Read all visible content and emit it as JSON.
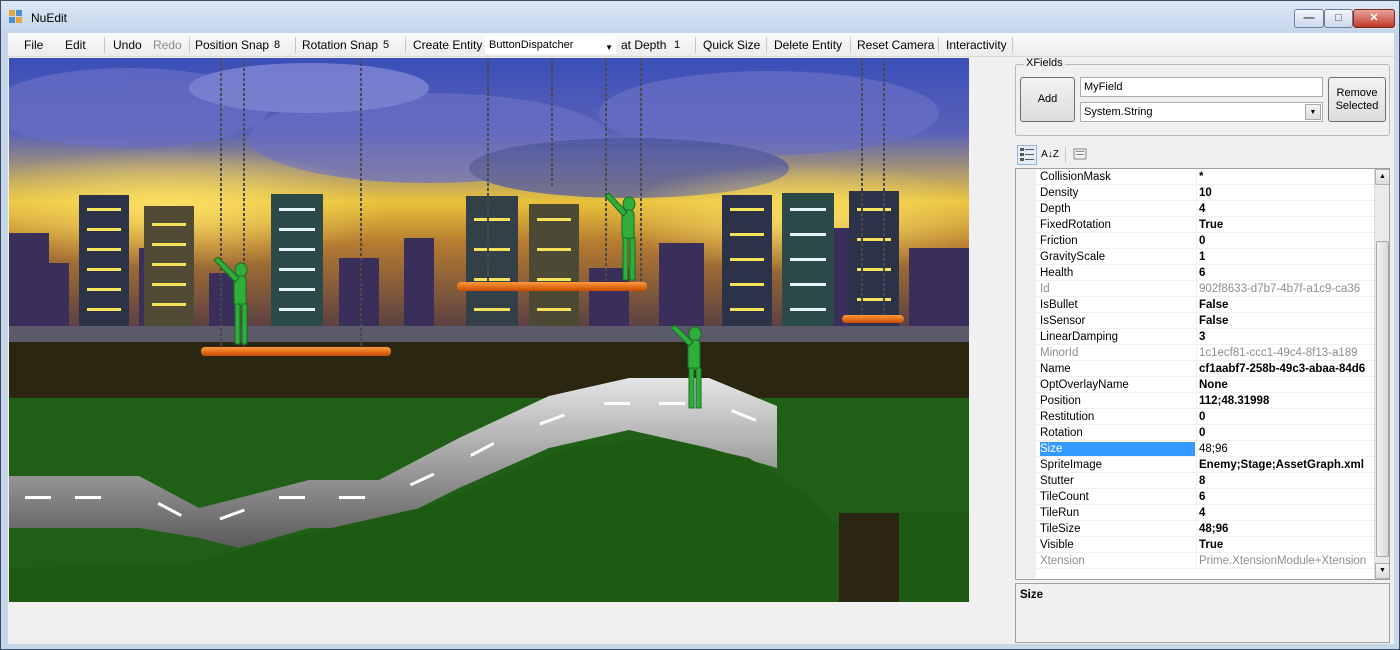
{
  "window": {
    "title": "NuEdit",
    "minimize_glyph": "—",
    "maximize_glyph": "□",
    "close_glyph": "✕"
  },
  "toolbar": {
    "file": "File",
    "edit": "Edit",
    "undo": "Undo",
    "redo": "Redo",
    "position_snap_label": "Position Snap",
    "position_snap_value": "8",
    "rotation_snap_label": "Rotation Snap",
    "rotation_snap_value": "5",
    "create_entity_label": "Create Entity",
    "entity_type": "ButtonDispatcher",
    "at_depth_label": "at Depth",
    "depth_value": "1",
    "quick_size": "Quick Size",
    "delete_entity": "Delete Entity",
    "reset_camera": "Reset Camera",
    "interactivity": "Interactivity"
  },
  "xfields": {
    "legend": "XFields",
    "add_label": "Add",
    "field_name": "MyField",
    "field_type": "System.String",
    "remove_label_1": "Remove",
    "remove_label_2": "Selected"
  },
  "properties": [
    {
      "key": "CollisionMask",
      "value": "*",
      "readonly": false
    },
    {
      "key": "Density",
      "value": "10",
      "readonly": false
    },
    {
      "key": "Depth",
      "value": "4",
      "readonly": false
    },
    {
      "key": "FixedRotation",
      "value": "True",
      "readonly": false
    },
    {
      "key": "Friction",
      "value": "0",
      "readonly": false
    },
    {
      "key": "GravityScale",
      "value": "1",
      "readonly": false
    },
    {
      "key": "Health",
      "value": "6",
      "readonly": false
    },
    {
      "key": "Id",
      "value": "902f8633-d7b7-4b7f-a1c9-ca36",
      "readonly": true
    },
    {
      "key": "IsBullet",
      "value": "False",
      "readonly": false
    },
    {
      "key": "IsSensor",
      "value": "False",
      "readonly": false
    },
    {
      "key": "LinearDamping",
      "value": "3",
      "readonly": false
    },
    {
      "key": "MinorId",
      "value": "1c1ecf81-ccc1-49c4-8f13-a189",
      "readonly": true
    },
    {
      "key": "Name",
      "value": "cf1aabf7-258b-49c3-abaa-84d6",
      "readonly": false
    },
    {
      "key": "OptOverlayName",
      "value": "None",
      "readonly": false
    },
    {
      "key": "Position",
      "value": "112;48.31998",
      "readonly": false
    },
    {
      "key": "Restitution",
      "value": "0",
      "readonly": false
    },
    {
      "key": "Rotation",
      "value": "0",
      "readonly": false
    },
    {
      "key": "Size",
      "value": "48;96",
      "readonly": false,
      "selected": true
    },
    {
      "key": "SpriteImage",
      "value": "Enemy;Stage;AssetGraph.xml",
      "readonly": false
    },
    {
      "key": "Stutter",
      "value": "8",
      "readonly": false
    },
    {
      "key": "TileCount",
      "value": "6",
      "readonly": false
    },
    {
      "key": "TileRun",
      "value": "4",
      "readonly": false
    },
    {
      "key": "TileSize",
      "value": "48;96",
      "readonly": false
    },
    {
      "key": "Visible",
      "value": "True",
      "readonly": false
    },
    {
      "key": "Xtension",
      "value": "Prime.XtensionModule+Xtension",
      "readonly": true
    }
  ],
  "description": {
    "title": "Size"
  },
  "icons": {
    "categorized": "categorized-icon",
    "alphabetical": "sort-az-icon",
    "property_pages": "property-pages-icon",
    "az_glyph": "A↓Z"
  },
  "colors": {
    "selection": "#3399ff",
    "platform": "#f06a0a",
    "enemy": "#2fae3c",
    "grass": "#1f5f16",
    "road": "#cfcfcf"
  }
}
